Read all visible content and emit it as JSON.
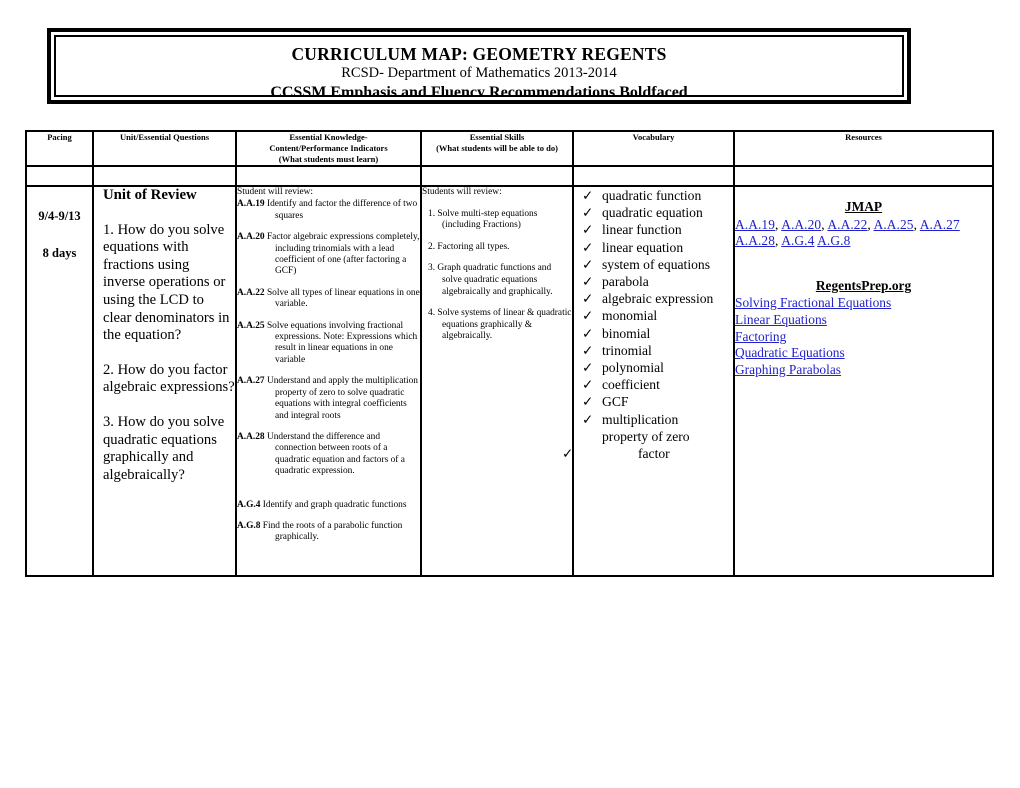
{
  "title_banner": {
    "line1": "CURRICULUM MAP: GEOMETRY REGENTS",
    "line2": "RCSD- Department of Mathematics 2013-2014",
    "line3": "CCSSM Emphasis and Fluency Recommendations Boldfaced"
  },
  "table": {
    "headers": {
      "pacing": "Pacing",
      "unit": "Unit/Essential Questions",
      "indicators_line1": "Essential Knowledge-",
      "indicators_line2": "Content/Performance Indicators",
      "indicators_line3": "(What students must learn)",
      "skills_line1": "Essential Skills",
      "skills_line2": "(What students will be able to do)",
      "vocabulary": "Vocabulary",
      "resources": "Resources"
    },
    "row": {
      "pacing": {
        "dates": "9/4-9/13",
        "days": "8 days"
      },
      "unit": {
        "title": "Unit of Review",
        "questions": [
          "1.  How do you solve equations with fractions using inverse operations or using the LCD to clear denominators in the equation?",
          "2.  How do you factor algebraic expressions?",
          "3.  How do you solve quadratic equations graphically and algebraically?"
        ]
      },
      "indicators": {
        "intro": "Student will review:",
        "items": [
          {
            "code": "A.A.19",
            "text": "Identify and factor the difference of two squares"
          },
          {
            "code": "A.A.20",
            "text": "Factor algebraic expressions completely, including trinomials with a lead  coefficient of one (after factoring a  GCF)"
          },
          {
            "code": "A.A.22",
            "text": "Solve all  types of linear equations in one variable."
          },
          {
            "code": "A.A.25",
            "text": "Solve equations involving fractional  expressions. Note: Expressions which  result in linear equations in one variable"
          },
          {
            "code": "A.A.27",
            "text": "Understand and apply the multiplication  property of zero to solve quadratic  equations with integral coefficients and integral roots"
          },
          {
            "code": "A.A.28",
            "text": "Understand the difference and connection between roots of a quadratic equation and factors of a quadratic expression."
          },
          {
            "code": "A.G.4",
            "text": "Identify and graph quadratic functions"
          },
          {
            "code": "A.G.8",
            "text": "Find the roots of a parabolic function graphically."
          }
        ]
      },
      "skills": {
        "intro": "Students will review:",
        "items": [
          "1. Solve multi-step equations (including Fractions)",
          "2.   Factoring all types.",
          "3.  Graph quadratic functions and solve quadratic equations algebraically and graphically.",
          "4.  Solve systems of linear & quadratic equations graphically & algebraically."
        ]
      },
      "vocabulary": {
        "check_glyph": "✓",
        "items": [
          "quadratic function",
          "quadratic equation",
          "linear function",
          "linear equation",
          "system of equations",
          "parabola",
          "algebraic expression",
          "monomial",
          "binomial",
          "trinomial",
          "polynomial",
          "coefficient",
          "GCF"
        ],
        "multiline_item": {
          "line1": "multiplication",
          "line2": "property of zero"
        },
        "last_item": "factor"
      },
      "resources": {
        "jmap_heading": "JMAP",
        "jmap_links_line1": [
          "A.A.19",
          "A.A.20",
          "A.A.22",
          "A.A.25",
          "A.A.27"
        ],
        "jmap_links_line2": [
          "A.A.28",
          "A.G.4",
          "A.G.8"
        ],
        "regentsprep_heading": "RegentsPrep.org",
        "regentsprep_links": [
          "Solving Fractional Equations",
          "Linear Equations",
          "Factoring",
          "Quadratic Equations",
          "Graphing Parabolas"
        ]
      }
    }
  },
  "colors": {
    "header_gray": "#a6a6a6",
    "link_blue": "#2222cc",
    "border": "#000000"
  }
}
